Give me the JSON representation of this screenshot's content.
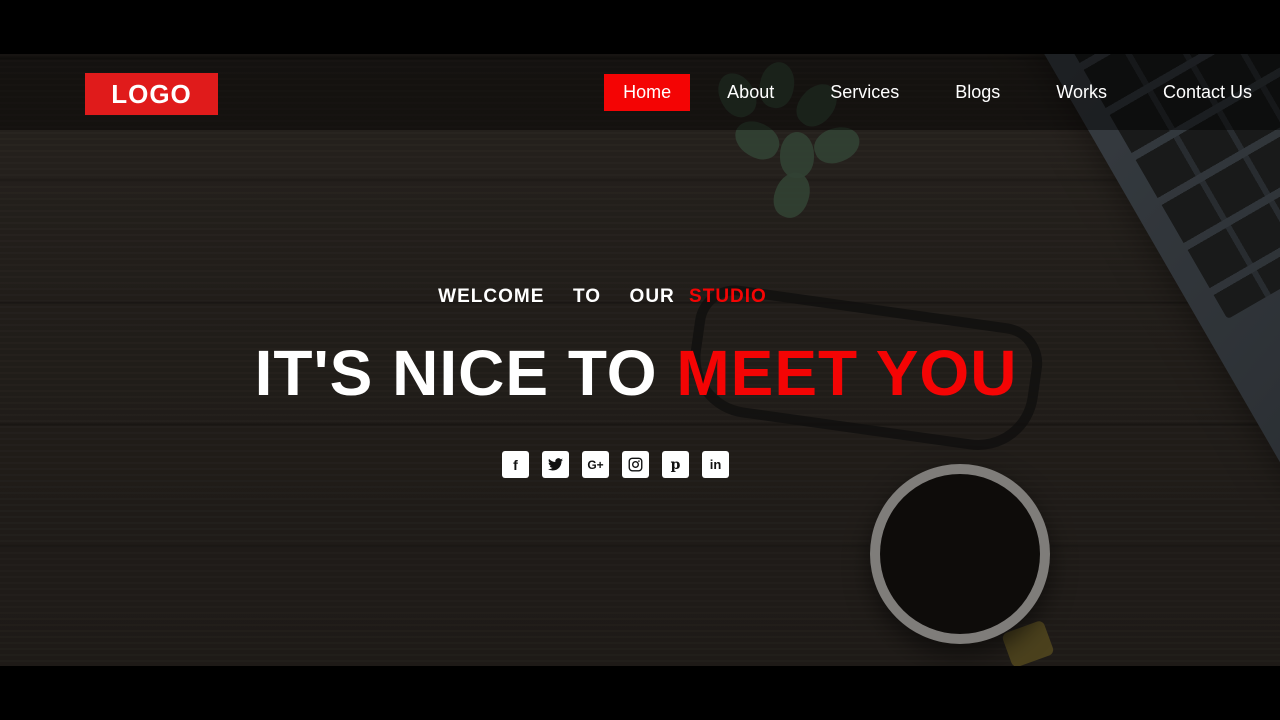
{
  "brand": {
    "logo": "LOGO",
    "accent": "#f40404"
  },
  "nav": {
    "items": [
      {
        "label": "Home",
        "active": true
      },
      {
        "label": "About"
      },
      {
        "label": "Services"
      },
      {
        "label": "Blogs"
      },
      {
        "label": "Works"
      },
      {
        "label": "Contact Us"
      }
    ]
  },
  "hero": {
    "welcome_prefix": "WELCOME  TO  OUR",
    "welcome_highlight": "STUDIO",
    "headline_prefix": "IT'S NICE TO",
    "headline_highlight": "MEET YOU"
  },
  "socials": [
    {
      "icon": "facebook-icon",
      "glyph": "f"
    },
    {
      "icon": "twitter-icon",
      "glyph": ""
    },
    {
      "icon": "google-plus-icon",
      "glyph": "G+"
    },
    {
      "icon": "instagram-icon",
      "glyph": ""
    },
    {
      "icon": "pinterest-icon",
      "glyph": "p"
    },
    {
      "icon": "linkedin-icon",
      "glyph": "in"
    }
  ]
}
